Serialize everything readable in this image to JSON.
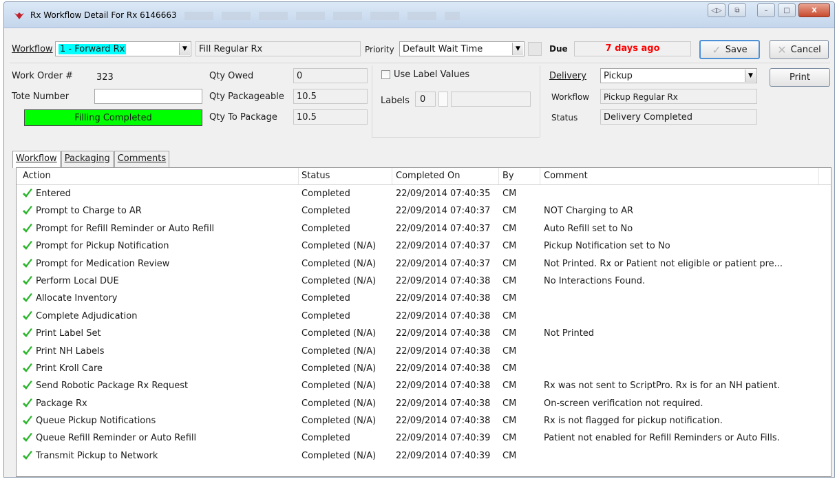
{
  "window": {
    "title": "Rx Workflow Detail For Rx 6146663",
    "buttons": [
      "◁▷",
      "⧉",
      "–",
      "□",
      "X"
    ]
  },
  "header": {
    "workflow_label": "Workflow",
    "workflow_value": "1 - Forward Rx",
    "workflow_color": "#00ffff",
    "workflow_name": "Fill Regular Rx",
    "priority_label": "Priority",
    "priority_value": "Default Wait Time",
    "due_label": "Due",
    "due_value": "7 days ago",
    "due_color": "#ff0000",
    "save_label": "Save",
    "cancel_label": "Cancel"
  },
  "order": {
    "work_order_label": "Work Order #",
    "work_order_value": "323",
    "tote_label": "Tote Number",
    "tote_value": "",
    "status_bar": "Filling Completed",
    "status_color": "#00ff00",
    "qty_owed_label": "Qty Owed",
    "qty_owed_value": "0",
    "qty_packageable_label": "Qty Packageable",
    "qty_packageable_value": "10.5",
    "qty_to_package_label": "Qty To Package",
    "qty_to_package_value": "10.5"
  },
  "labels_box": {
    "use_label_values": "Use Label Values",
    "labels_label": "Labels",
    "labels_value": "0"
  },
  "delivery": {
    "delivery_label": "Delivery",
    "delivery_value": "Pickup",
    "workflow_label": "Workflow",
    "workflow_value": "Pickup Regular Rx",
    "status_label": "Status",
    "status_value": "Delivery Completed",
    "print_label": "Print"
  },
  "tabs": [
    {
      "label": "Workflow",
      "active": true
    },
    {
      "label": "Packaging",
      "active": false
    },
    {
      "label": "Comments",
      "active": false
    }
  ],
  "columns": [
    "Action",
    "Status",
    "Completed On",
    "By",
    "Comment"
  ],
  "rows": [
    [
      "Entered",
      "Completed",
      "22/09/2014 07:40:35",
      "CM",
      ""
    ],
    [
      "Prompt to Charge to AR",
      "Completed",
      "22/09/2014 07:40:37",
      "CM",
      "NOT Charging to AR"
    ],
    [
      "Prompt for Refill Reminder or Auto Refill",
      "Completed",
      "22/09/2014 07:40:37",
      "CM",
      "Auto Refill set to No"
    ],
    [
      "Prompt for Pickup Notification",
      "Completed (N/A)",
      "22/09/2014 07:40:37",
      "CM",
      "Pickup Notification set to No"
    ],
    [
      "Prompt for Medication Review",
      "Completed (N/A)",
      "22/09/2014 07:40:37",
      "CM",
      "Not Printed.  Rx or Patient not eligible or patient pre..."
    ],
    [
      "Perform Local DUE",
      "Completed (N/A)",
      "22/09/2014 07:40:38",
      "CM",
      "No Interactions Found."
    ],
    [
      "Allocate Inventory",
      "Completed",
      "22/09/2014 07:40:38",
      "CM",
      ""
    ],
    [
      "Complete Adjudication",
      "Completed",
      "22/09/2014 07:40:38",
      "CM",
      ""
    ],
    [
      "Print Label Set",
      "Completed (N/A)",
      "22/09/2014 07:40:38",
      "CM",
      "Not Printed"
    ],
    [
      "Print NH Labels",
      "Completed (N/A)",
      "22/09/2014 07:40:38",
      "CM",
      ""
    ],
    [
      "Print Kroll Care",
      "Completed (N/A)",
      "22/09/2014 07:40:38",
      "CM",
      ""
    ],
    [
      "Send Robotic Package Rx Request",
      "Completed (N/A)",
      "22/09/2014 07:40:38",
      "CM",
      "Rx was not sent to ScriptPro.  Rx is for an NH patient."
    ],
    [
      "Package Rx",
      "Completed (N/A)",
      "22/09/2014 07:40:38",
      "CM",
      "On-screen verification not required."
    ],
    [
      "Queue Pickup Notifications",
      "Completed (N/A)",
      "22/09/2014 07:40:38",
      "CM",
      "Rx is not flagged for pickup notification."
    ],
    [
      "Queue Refill Reminder or Auto Refill",
      "Completed",
      "22/09/2014 07:40:39",
      "CM",
      "Patient not enabled for Refill Reminders or Auto Fills."
    ],
    [
      "Transmit Pickup to Network",
      "Completed (N/A)",
      "22/09/2014 07:40:39",
      "CM",
      ""
    ]
  ],
  "colors": {
    "check": "#2db52d"
  }
}
